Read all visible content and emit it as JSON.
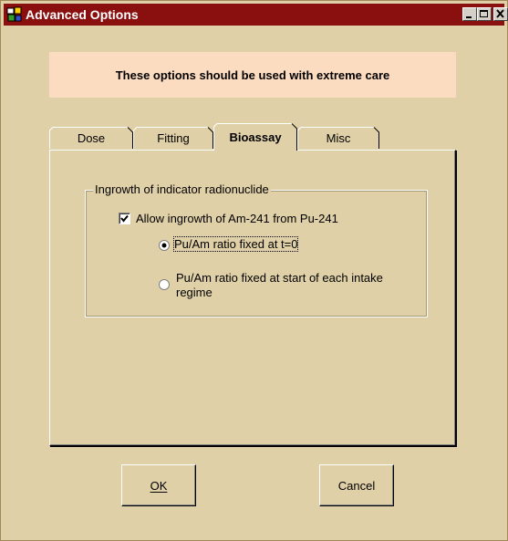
{
  "window": {
    "title": "Advanced Options",
    "icon": "app-icon",
    "controls": [
      "minimize-icon",
      "maximize-icon",
      "close-icon"
    ]
  },
  "warning": {
    "text": "These options should be used with extreme care",
    "color": "#fcdcc0"
  },
  "tabs": [
    {
      "label": "Dose",
      "active": false
    },
    {
      "label": "Fitting",
      "active": false
    },
    {
      "label": "Bioassay",
      "active": true
    },
    {
      "label": "Misc",
      "active": false
    }
  ],
  "group": {
    "legend": "Ingrowth of indicator radionuclide",
    "checkbox": {
      "label": "Allow ingrowth of Am-241 from Pu-241",
      "checked": true
    },
    "radios": [
      {
        "label": "Pu/Am ratio fixed at t=0",
        "selected": true
      },
      {
        "label_line1": "Pu/Am ratio fixed at start of each intake",
        "label_line2": "regime",
        "selected": false
      }
    ]
  },
  "buttons": {
    "ok": "OK",
    "cancel": "Cancel"
  },
  "colors": {
    "titlebar": "#8a1010",
    "background": "#e0d0a8"
  }
}
